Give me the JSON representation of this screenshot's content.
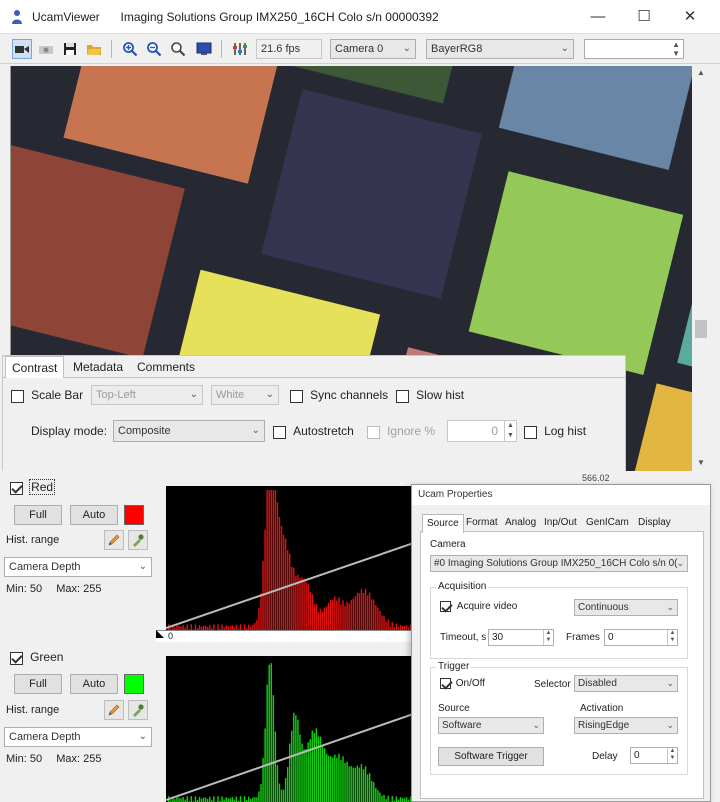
{
  "window": {
    "app_name": "UcamViewer",
    "title_detail": "Imaging Solutions Group IMX250_16CH Colo s/n 00000392",
    "controls": {
      "minimize": "—",
      "maximize": "☐",
      "close": "✕"
    }
  },
  "toolbar": {
    "fps": "21.6 fps",
    "camera_select": "Camera 0",
    "format_select": "BayerRG8",
    "extra_select": ""
  },
  "contrast_panel": {
    "tabs": [
      {
        "label": "Contrast",
        "active": true
      },
      {
        "label": "Metadata",
        "active": false
      },
      {
        "label": "Comments",
        "active": false
      }
    ],
    "scale_bar_label": "Scale Bar",
    "scale_bar_position": "Top-Left",
    "scale_bar_color": "White",
    "sync_channels_label": "Sync channels",
    "slow_hist_label": "Slow hist",
    "display_mode_label": "Display mode:",
    "display_mode_value": "Composite",
    "autostretch_label": "Autostretch",
    "ignore_label": "Ignore %",
    "ignore_value": "0",
    "log_hist_label": "Log hist",
    "corner_value": "566.02"
  },
  "channels": [
    {
      "name": "Red",
      "checked": true,
      "full_label": "Full",
      "auto_label": "Auto",
      "color": "#ff0000",
      "hist_range_label": "Hist. range",
      "depth_select": "Camera Depth",
      "min_label": "Min:",
      "min_value": "50",
      "max_label": "Max:",
      "max_value": "255",
      "axis_label": "0",
      "bar_color": "#e01010"
    },
    {
      "name": "Green",
      "checked": true,
      "full_label": "Full",
      "auto_label": "Auto",
      "color": "#00ff00",
      "hist_range_label": "Hist. range",
      "depth_select": "Camera Depth",
      "min_label": "Min:",
      "min_value": "50",
      "max_label": "Max:",
      "max_value": "255",
      "axis_label": "",
      "bar_color": "#10d010"
    }
  ],
  "properties": {
    "title": "Ucam Properties",
    "tabs": [
      {
        "label": "Source",
        "active": true
      },
      {
        "label": "Format",
        "active": false
      },
      {
        "label": "Analog",
        "active": false
      },
      {
        "label": "Inp/Out",
        "active": false
      },
      {
        "label": "GenICam",
        "active": false
      },
      {
        "label": "Display",
        "active": false
      }
    ],
    "camera_label": "Camera",
    "camera_value": "#0 Imaging Solutions Group IMX250_16CH Colo s/n 0(",
    "acquisition_label": "Acquisition",
    "acquire_video_label": "Acquire video",
    "acquire_mode": "Continuous",
    "timeout_label": "Timeout, s",
    "timeout_value": "30",
    "frames_label": "Frames",
    "frames_value": "0",
    "trigger_label": "Trigger",
    "onoff_label": "On/Off",
    "selector_label": "Selector",
    "selector_value": "Disabled",
    "source_label": "Source",
    "source_value": "Software",
    "activation_label": "Activation",
    "activation_value": "RisingEdge",
    "software_trigger_label": "Software Trigger",
    "delay_label": "Delay",
    "delay_value": "0"
  },
  "colors": {
    "patch_orange": "#c77451",
    "patch_navy": "#35334f",
    "patch_steel": "#6a86a6",
    "patch_green": "#94c95a",
    "patch_teal": "#5aab9c",
    "patch_brick": "#8f4438",
    "patch_yellow": "#e6e05a",
    "patch_gold": "#e2b640",
    "patch_darkgreen": "#3c5836",
    "patch_pink": "#c07a7a",
    "patch_blue": "#3b5f95"
  }
}
